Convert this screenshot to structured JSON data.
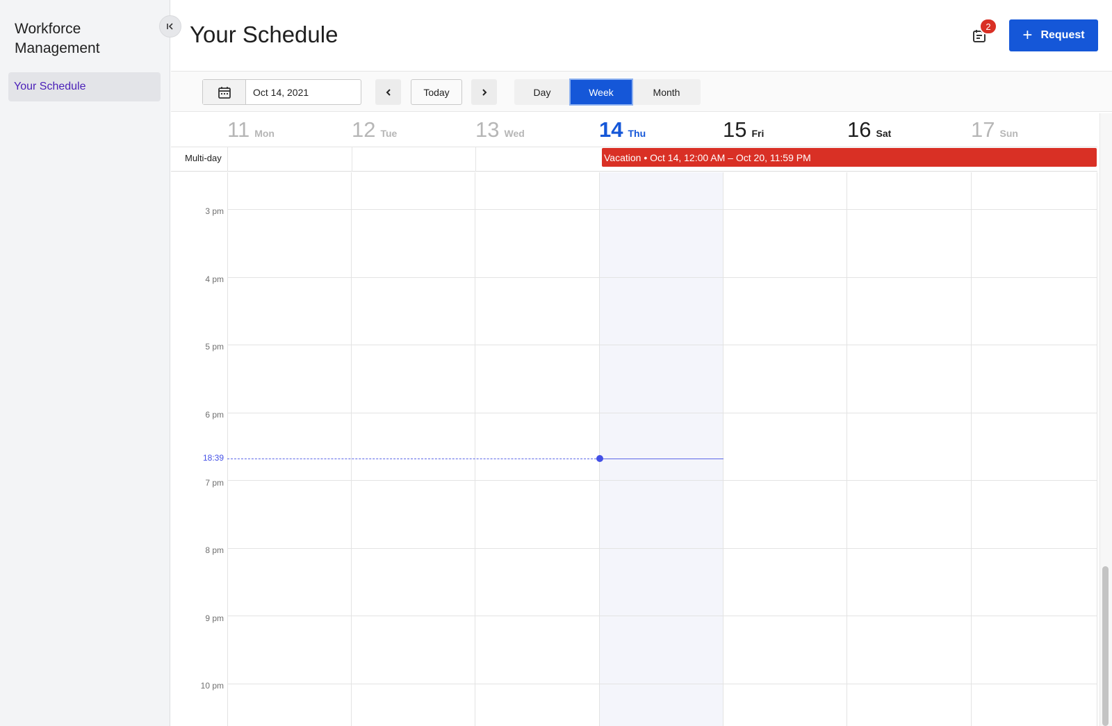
{
  "app": {
    "title": "Workforce Management"
  },
  "sidebar": {
    "collapse_icon": "collapse-left-icon",
    "items": [
      {
        "label": "Your Schedule",
        "active": true
      }
    ]
  },
  "header": {
    "title": "Your Schedule",
    "notification_count": "2",
    "notification_icon": "schedule-list-icon",
    "request_button": "Request"
  },
  "toolbar": {
    "date_value": "Oct 14, 2021",
    "today_label": "Today",
    "views": [
      "Day",
      "Week",
      "Month"
    ],
    "active_view": "Week"
  },
  "calendar": {
    "days": [
      {
        "num": "11",
        "dow": "Mon",
        "state": "past"
      },
      {
        "num": "12",
        "dow": "Tue",
        "state": "past"
      },
      {
        "num": "13",
        "dow": "Wed",
        "state": "past"
      },
      {
        "num": "14",
        "dow": "Thu",
        "state": "today"
      },
      {
        "num": "15",
        "dow": "Fri",
        "state": "future"
      },
      {
        "num": "16",
        "dow": "Sat",
        "state": "future"
      },
      {
        "num": "17",
        "dow": "Sun",
        "state": "past"
      }
    ],
    "multiday_label": "Multi-day",
    "events": [
      {
        "label": "Vacation • Oct 14, 12:00 AM – Oct 20, 11:59 PM",
        "color": "#d93025"
      }
    ],
    "hours": [
      "3 pm",
      "4 pm",
      "5 pm",
      "6 pm",
      "7 pm",
      "8 pm",
      "9 pm",
      "10 pm"
    ],
    "current_time": "18:39"
  },
  "colors": {
    "accent": "#1557d8",
    "event": "#d93025",
    "now_line": "#4350e6"
  }
}
